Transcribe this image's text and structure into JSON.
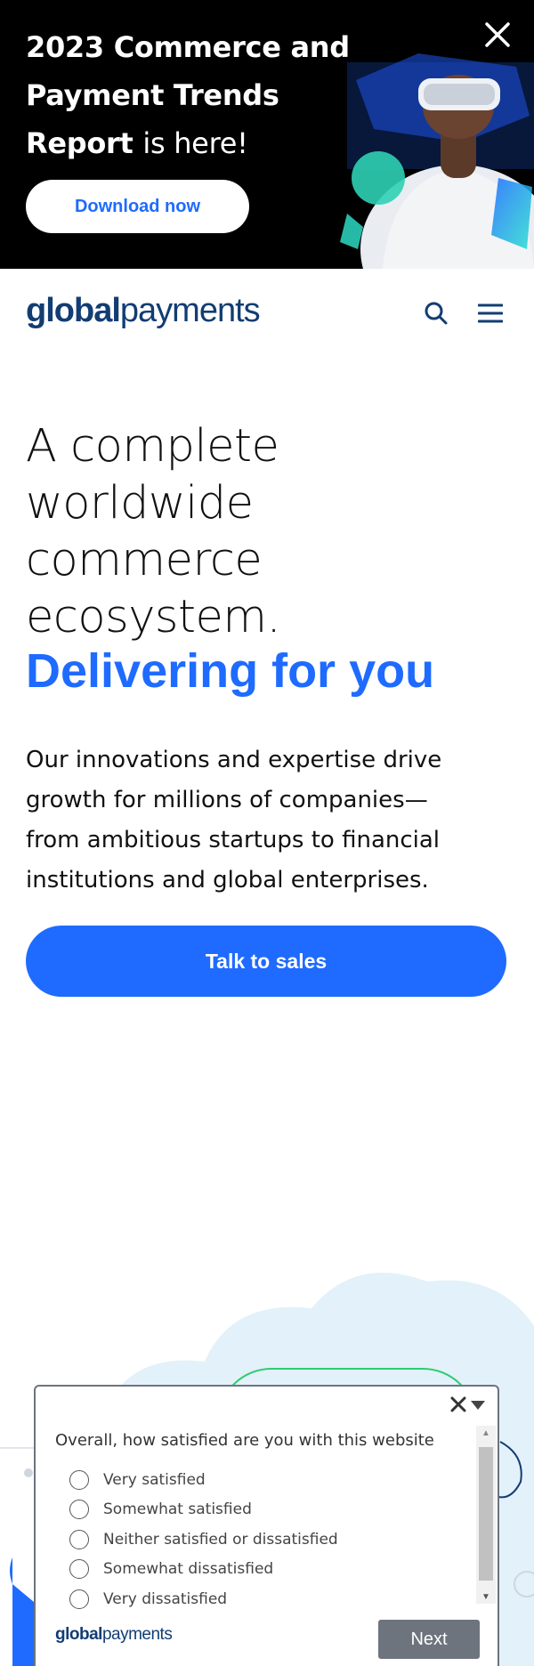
{
  "promo": {
    "title_bold": "2023 Commerce and Payment Trends Report",
    "title_light": "is here!",
    "download_label": "Download now",
    "close_icon": "close-icon"
  },
  "header": {
    "logo_bold": "global",
    "logo_light": "payments",
    "search_icon": "search-icon",
    "menu_icon": "hamburger-menu-icon"
  },
  "hero": {
    "title_lines": [
      "A complete",
      "worldwide",
      "commerce",
      "ecosystem."
    ],
    "accent": "Delivering for you",
    "body": "Our innovations and expertise drive growth for millions of companies— from ambitious startups to financial institutions and global enterprises.",
    "cta_label": "Talk to sales"
  },
  "survey": {
    "question": "Overall, how satisfied are you with this website",
    "options": [
      "Very satisfied",
      "Somewhat satisfied",
      "Neither satisfied or dissatisfied",
      "Somewhat dissatisfied",
      "Very dissatisfied"
    ],
    "logo_bold": "global",
    "logo_light": "payments",
    "next_label": "Next"
  },
  "colors": {
    "brand_blue": "#1f6bff",
    "logo_navy": "#123d73",
    "promo_bg": "#000000",
    "survey_button": "#6d747d"
  }
}
